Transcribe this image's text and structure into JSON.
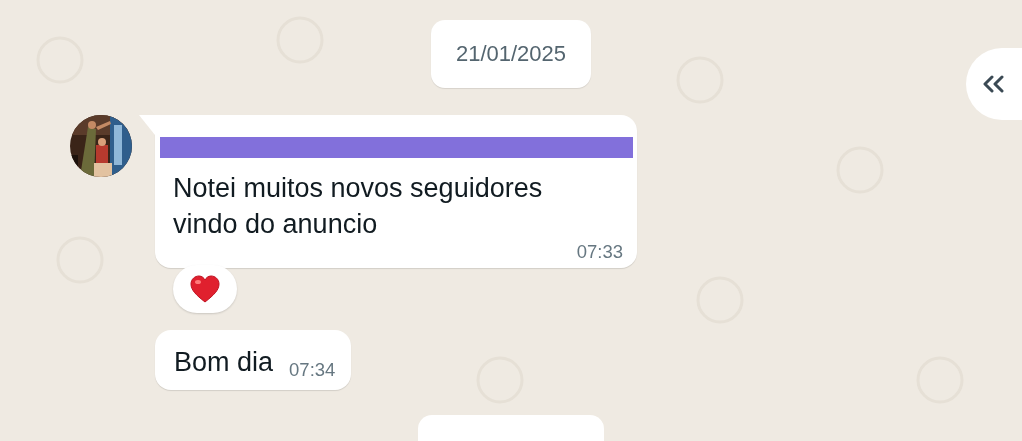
{
  "date_chip": "21/01/2025",
  "messages": [
    {
      "show_avatar": true,
      "redacted": true,
      "text": "Notei muitos novos seguidores vindo do anuncio",
      "time": "07:33",
      "reaction": {
        "kind": "heart"
      }
    },
    {
      "show_avatar": false,
      "redacted": false,
      "text": "Bom dia",
      "time": "07:34"
    }
  ]
}
